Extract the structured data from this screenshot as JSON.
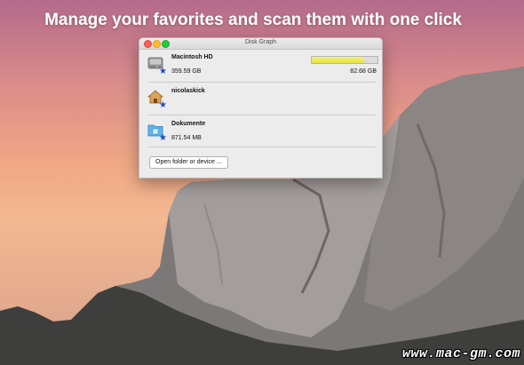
{
  "headline": "Manage your favorites and scan them with one click",
  "window": {
    "title": "Disk Graph",
    "items": [
      {
        "name": "Macintosh HD",
        "size": "359.59 GB",
        "free": "82.68 GB",
        "usage_percent": 80,
        "icon": "hard-drive-icon"
      },
      {
        "name": "nicolaskick",
        "size": "",
        "free": "",
        "icon": "home-folder-icon"
      },
      {
        "name": "Dokumente",
        "size": "871.54 MB",
        "free": "",
        "icon": "documents-folder-icon"
      }
    ],
    "open_button_label": "Open folder or device ..."
  },
  "watermark": "www.mac-gm.com",
  "colors": {
    "favorite_star": "#1a49c6",
    "usage_bar": "#e8e23c"
  }
}
